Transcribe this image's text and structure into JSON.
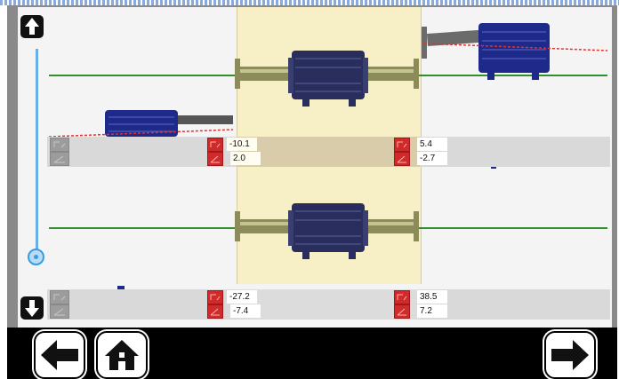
{
  "colors": {
    "center_band": "#f7efc6",
    "reference_line": "#2f8f2f",
    "misalignment_line": "#e23030",
    "motor_body": "#1e2a8a",
    "button_red": "#d12a2a",
    "slider": "#3a9be0"
  },
  "icons": {
    "scroll_up": "arrow-up-icon",
    "scroll_down": "arrow-down-icon",
    "back": "arrow-left-icon",
    "home": "home-icon",
    "next": "arrow-right-icon",
    "offset_adjust": "vertical-offset-icon",
    "angle_adjust": "angle-icon"
  },
  "horizontal_view": {
    "left_feet": {
      "offset": "-10.1",
      "angle": "2.0"
    },
    "right_feet": {
      "offset": "5.4",
      "angle": "-2.7"
    }
  },
  "vertical_view": {
    "left_feet": {
      "offset": "-27.2",
      "angle": "-7.4"
    },
    "right_feet": {
      "offset": "38.5",
      "angle": "7.2"
    }
  }
}
